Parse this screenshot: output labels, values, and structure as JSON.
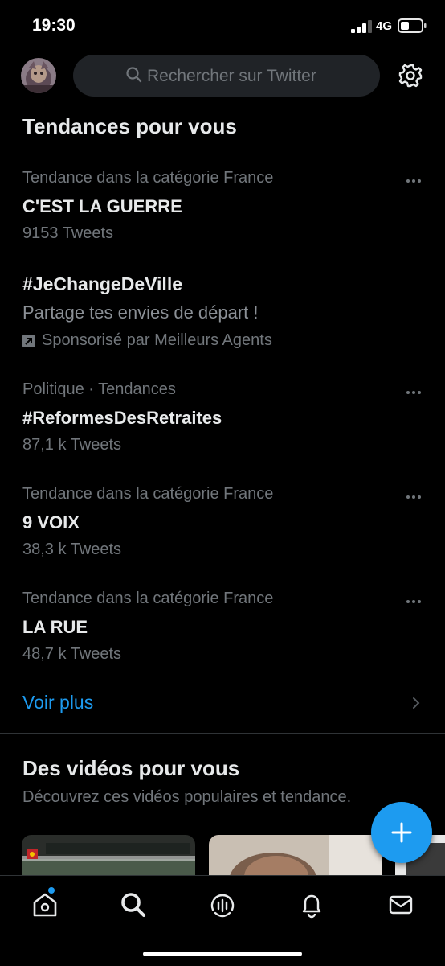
{
  "status_bar": {
    "time": "19:30",
    "network": "4G"
  },
  "search": {
    "placeholder": "Rechercher sur Twitter"
  },
  "trends_section": {
    "title": "Tendances pour vous",
    "items": [
      {
        "context": "Tendance dans la catégorie France",
        "name": "C'EST LA GUERRE",
        "count": "9153 Tweets"
      },
      {
        "context": "Politique · Tendances",
        "name": "#ReformesDesRetraites",
        "count": "87,1 k Tweets"
      },
      {
        "context": "Tendance dans la catégorie France",
        "name": "9 VOIX",
        "count": "38,3 k Tweets"
      },
      {
        "context": "Tendance dans la catégorie France",
        "name": "LA RUE",
        "count": "48,7 k Tweets"
      }
    ],
    "promoted": {
      "name": "#JeChangeDeVille",
      "description": "Partage tes envies de départ !",
      "sponsor": "Sponsorisé par Meilleurs Agents"
    },
    "show_more": "Voir plus"
  },
  "videos_section": {
    "title": "Des vidéos pour vous",
    "subtitle": "Découvrez ces vidéos populaires et tendance."
  },
  "tab_bar": {
    "tabs": [
      "home-icon",
      "search-icon",
      "spaces-icon",
      "notifications-icon",
      "messages-icon"
    ],
    "home_has_notification": true
  },
  "colors": {
    "accent": "#1d9bf0",
    "background": "#000000",
    "secondary_text": "#71767b"
  }
}
